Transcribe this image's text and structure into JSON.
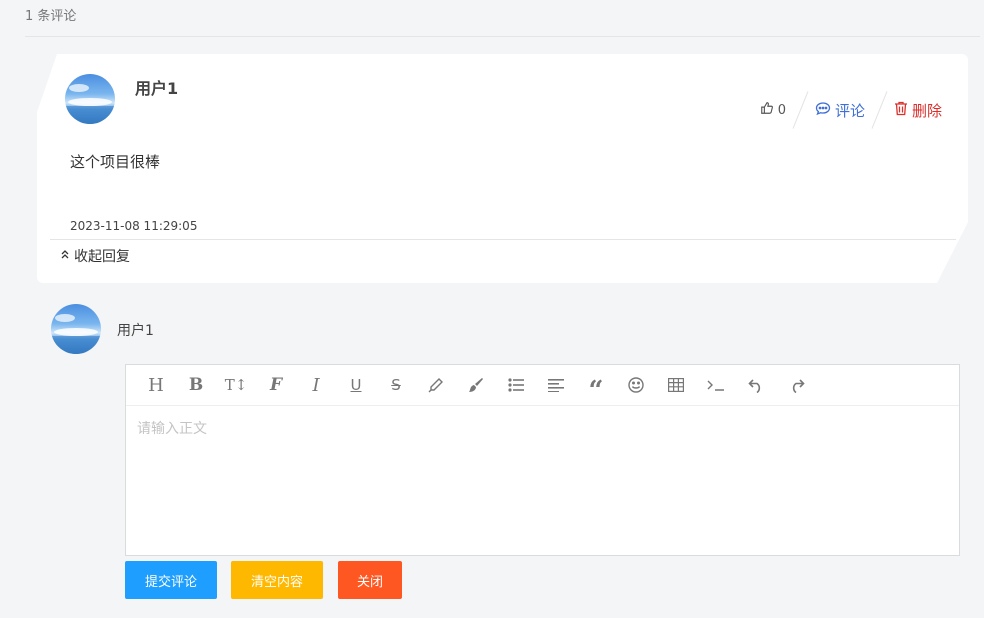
{
  "comments": {
    "count_label": "1 条评论",
    "item": {
      "username": "用户1",
      "content": "这个项目很棒",
      "timestamp": "2023-11-08 11:29:05",
      "likes": "0",
      "reply_label": "评论",
      "delete_label": "删除",
      "collapse_label": "收起回复"
    }
  },
  "reply": {
    "username": "用户1",
    "placeholder": "请输入正文",
    "toolbar": [
      "heading-icon",
      "bold-icon",
      "font-size-icon",
      "font-family-icon",
      "italic-icon",
      "underline-icon",
      "strikethrough-icon",
      "highlight-pen-icon",
      "brush-icon",
      "list-icon",
      "align-icon",
      "quote-icon",
      "emoji-icon",
      "table-icon",
      "code-icon",
      "undo-icon",
      "redo-icon"
    ],
    "buttons": {
      "submit": "提交评论",
      "clear": "清空内容",
      "close": "关闭"
    }
  },
  "colors": {
    "submit": "#1e9fff",
    "clear": "#ffb800",
    "close": "#ff5722",
    "reply_link": "#3f6fd8",
    "delete_link": "#d9302c"
  }
}
